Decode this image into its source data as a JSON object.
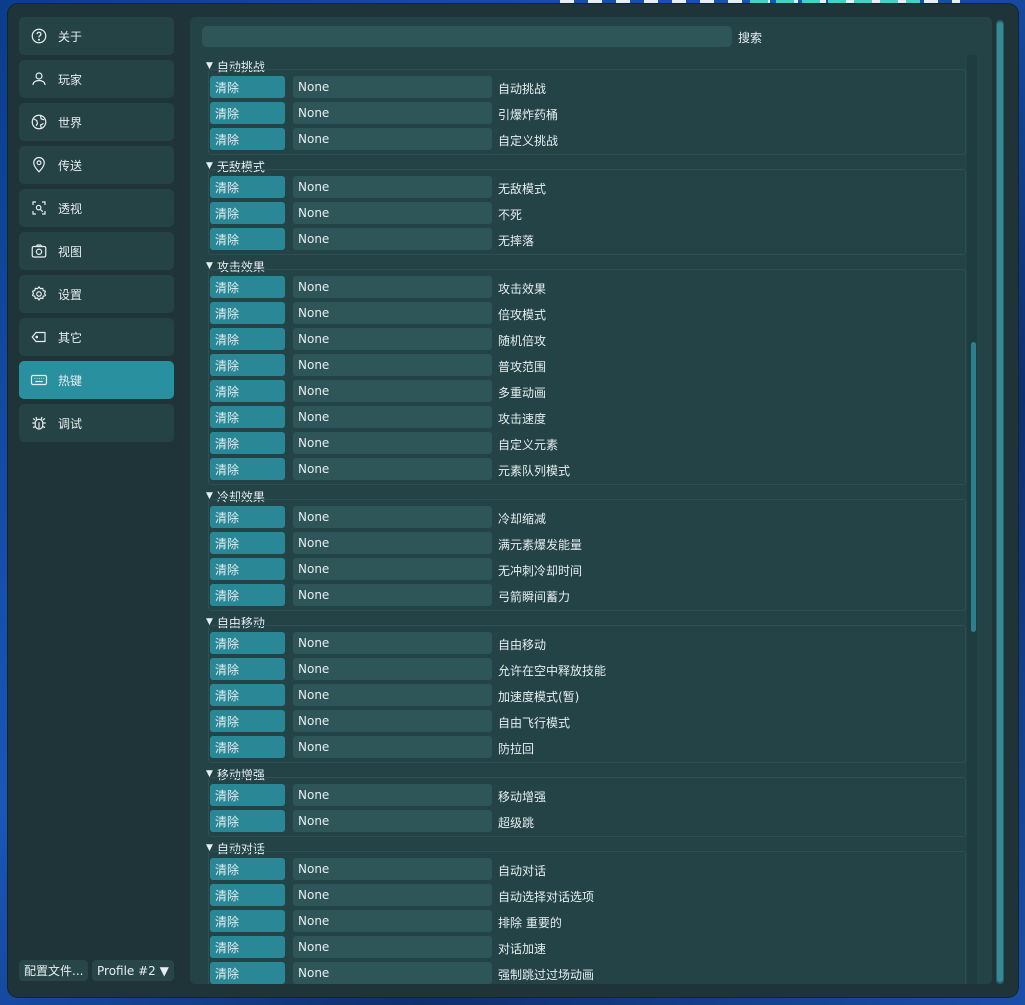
{
  "sidebar": {
    "items": [
      {
        "label": "关于",
        "icon": "help-circle-icon"
      },
      {
        "label": "玩家",
        "icon": "user-icon"
      },
      {
        "label": "世界",
        "icon": "globe-icon"
      },
      {
        "label": "传送",
        "icon": "map-pin-icon"
      },
      {
        "label": "透视",
        "icon": "scan-icon"
      },
      {
        "label": "视图",
        "icon": "camera-icon"
      },
      {
        "label": "设置",
        "icon": "gear-icon"
      },
      {
        "label": "其它",
        "icon": "tag-icon"
      },
      {
        "label": "热键",
        "icon": "keyboard-icon",
        "active": true
      },
      {
        "label": "调试",
        "icon": "bug-icon"
      }
    ],
    "config_button": "配置文件...",
    "profile_select": "Profile #2 ▼"
  },
  "search": {
    "value": "",
    "label": "搜索"
  },
  "hotkeys": {
    "clear_label": "清除",
    "groups": [
      {
        "title": "自动挑战",
        "rows": [
          {
            "key": "None",
            "label": "自动挑战"
          },
          {
            "key": "None",
            "label": "引爆炸药桶"
          },
          {
            "key": "None",
            "label": "自定义挑战"
          }
        ]
      },
      {
        "title": "无敌模式",
        "rows": [
          {
            "key": "None",
            "label": "无敌模式"
          },
          {
            "key": "None",
            "label": "不死"
          },
          {
            "key": "None",
            "label": "无摔落"
          }
        ]
      },
      {
        "title": "攻击效果",
        "rows": [
          {
            "key": "None",
            "label": "攻击效果"
          },
          {
            "key": "None",
            "label": "倍攻模式"
          },
          {
            "key": "None",
            "label": "随机倍攻"
          },
          {
            "key": "None",
            "label": "普攻范围"
          },
          {
            "key": "None",
            "label": "多重动画"
          },
          {
            "key": "None",
            "label": "攻击速度"
          },
          {
            "key": "None",
            "label": "自定义元素"
          },
          {
            "key": "None",
            "label": "元素队列模式"
          }
        ]
      },
      {
        "title": "冷却效果",
        "rows": [
          {
            "key": "None",
            "label": "冷却缩减"
          },
          {
            "key": "None",
            "label": "满元素爆发能量"
          },
          {
            "key": "None",
            "label": "无冲刺冷却时间"
          },
          {
            "key": "None",
            "label": "弓箭瞬间蓄力"
          }
        ]
      },
      {
        "title": "自由移动",
        "rows": [
          {
            "key": "None",
            "label": "自由移动"
          },
          {
            "key": "None",
            "label": "允许在空中释放技能"
          },
          {
            "key": "None",
            "label": "加速度模式(暂)"
          },
          {
            "key": "None",
            "label": "自由飞行模式"
          },
          {
            "key": "None",
            "label": "防拉回"
          }
        ]
      },
      {
        "title": "移动增强",
        "rows": [
          {
            "key": "None",
            "label": "移动增强"
          },
          {
            "key": "None",
            "label": "超级跳"
          }
        ]
      },
      {
        "title": "自动对话",
        "rows": [
          {
            "key": "None",
            "label": "自动对话"
          },
          {
            "key": "None",
            "label": "自动选择对话选项"
          },
          {
            "key": "None",
            "label": "排除 重要的"
          },
          {
            "key": "None",
            "label": "对话加速"
          },
          {
            "key": "None",
            "label": "强制跳过过场动画"
          }
        ]
      }
    ]
  }
}
